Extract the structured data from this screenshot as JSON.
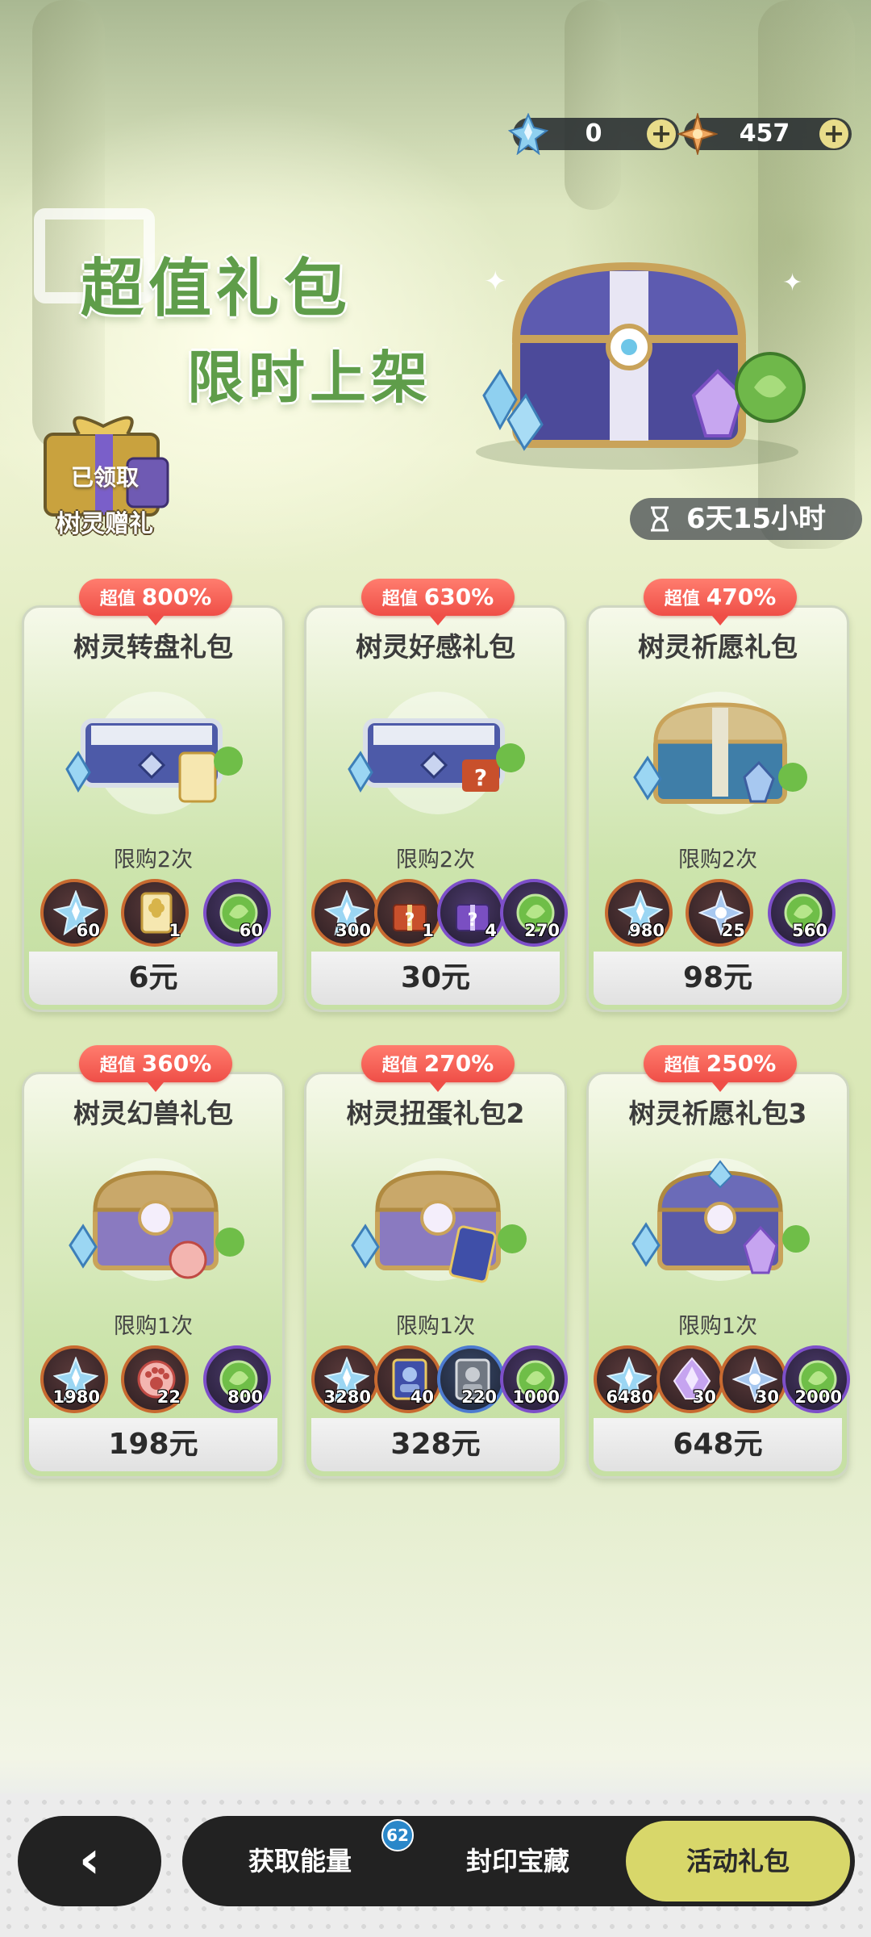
{
  "currency": [
    {
      "icon": "blue-crystal-icon",
      "value": "0"
    },
    {
      "icon": "gold-star-crystal-icon",
      "value": "457"
    }
  ],
  "hero": {
    "line1": "超值礼包",
    "line2": "限时上架"
  },
  "claimed_gift": {
    "status": "已领取",
    "name": "树灵赠礼"
  },
  "timer": "6天15小时",
  "packs": [
    {
      "discount_prefix": "超值",
      "discount": "800%",
      "title": "树灵转盘礼包",
      "limit": "限购2次",
      "price": "6元",
      "items": [
        {
          "icon": "blue-crystal-icon",
          "qty": "60",
          "frame": "orange"
        },
        {
          "icon": "golden-clover-ticket-icon",
          "qty": "1",
          "frame": "orange"
        },
        {
          "icon": "green-leaf-orb-icon",
          "qty": "60",
          "frame": "purple"
        }
      ]
    },
    {
      "discount_prefix": "超值",
      "discount": "630%",
      "title": "树灵好感礼包",
      "limit": "限购2次",
      "price": "30元",
      "items": [
        {
          "icon": "blue-crystal-icon",
          "qty": "300",
          "frame": "orange"
        },
        {
          "icon": "mystery-gift-red-icon",
          "qty": "1",
          "frame": "orange"
        },
        {
          "icon": "mystery-gift-purple-icon",
          "qty": "4",
          "frame": "purple"
        },
        {
          "icon": "green-leaf-orb-icon",
          "qty": "270",
          "frame": "purple"
        }
      ]
    },
    {
      "discount_prefix": "超值",
      "discount": "470%",
      "title": "树灵祈愿礼包",
      "limit": "限购2次",
      "price": "98元",
      "items": [
        {
          "icon": "blue-crystal-icon",
          "qty": "980",
          "frame": "orange"
        },
        {
          "icon": "silver-star-crystal-icon",
          "qty": "25",
          "frame": "orange"
        },
        {
          "icon": "green-leaf-orb-icon",
          "qty": "560",
          "frame": "purple"
        }
      ]
    },
    {
      "discount_prefix": "超值",
      "discount": "360%",
      "title": "树灵幻兽礼包",
      "limit": "限购1次",
      "price": "198元",
      "items": [
        {
          "icon": "blue-crystal-icon",
          "qty": "1980",
          "frame": "orange"
        },
        {
          "icon": "paw-token-icon",
          "qty": "22",
          "frame": "orange"
        },
        {
          "icon": "green-leaf-orb-icon",
          "qty": "800",
          "frame": "purple"
        }
      ]
    },
    {
      "discount_prefix": "超值",
      "discount": "270%",
      "title": "树灵扭蛋礼包2",
      "limit": "限购1次",
      "price": "328元",
      "items": [
        {
          "icon": "blue-crystal-icon",
          "qty": "3280",
          "frame": "orange"
        },
        {
          "icon": "character-card-icon",
          "qty": "40",
          "frame": "orange"
        },
        {
          "icon": "silver-card-icon",
          "qty": "220",
          "frame": "blue"
        },
        {
          "icon": "green-leaf-orb-icon",
          "qty": "1000",
          "frame": "purple"
        }
      ]
    },
    {
      "discount_prefix": "超值",
      "discount": "250%",
      "title": "树灵祈愿礼包3",
      "limit": "限购1次",
      "price": "648元",
      "items": [
        {
          "icon": "blue-crystal-icon",
          "qty": "6480",
          "frame": "orange"
        },
        {
          "icon": "purple-crystal-icon",
          "qty": "30",
          "frame": "orange"
        },
        {
          "icon": "silver-star-crystal-icon",
          "qty": "30",
          "frame": "orange"
        },
        {
          "icon": "green-leaf-orb-icon",
          "qty": "2000",
          "frame": "purple"
        }
      ]
    }
  ],
  "nav": {
    "back_label": "‹",
    "tabs": [
      {
        "label": "获取能量",
        "badge": "62"
      },
      {
        "label": "封印宝藏"
      },
      {
        "label": "活动礼包",
        "active": true
      }
    ]
  },
  "colors": {
    "accent": "#d8d76a",
    "badge_red": "#ef4e47",
    "hero_green": "#5f9d4a"
  }
}
